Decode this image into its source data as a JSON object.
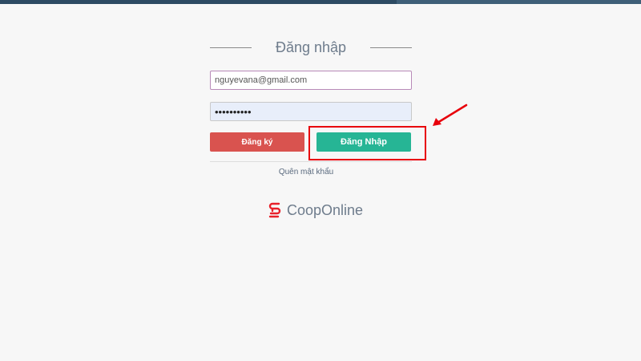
{
  "page": {
    "title": "Đăng nhập"
  },
  "form": {
    "email_value": "nguyevana@gmail.com",
    "password_value": "••••••••••"
  },
  "buttons": {
    "register_label": "Đăng ký",
    "login_label": "Đăng Nhập"
  },
  "links": {
    "forgot_password": "Quên mật khẩu"
  },
  "brand": {
    "name": "CoopOnline"
  },
  "colors": {
    "topbar": "#2d4b63",
    "register_button": "#d9534f",
    "login_button": "#26b595",
    "highlight": "#e8000b",
    "logo_red": "#e8202a"
  },
  "icons": {
    "logo": "coop-logo-icon",
    "annotation_arrow": "red-arrow-icon"
  }
}
